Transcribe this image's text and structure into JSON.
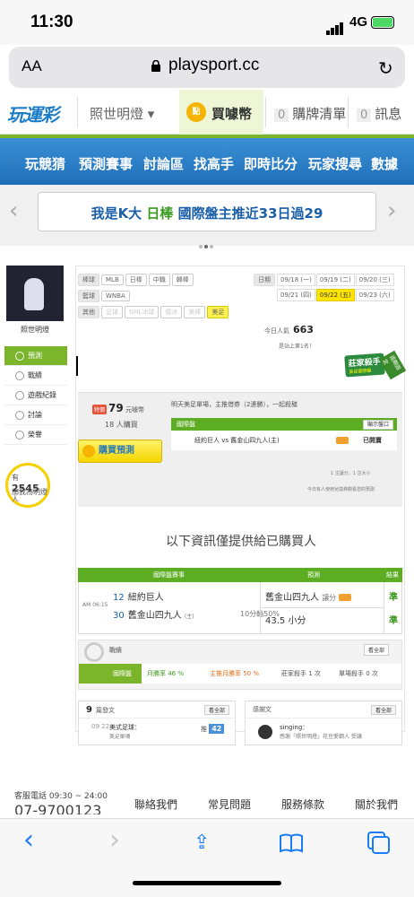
{
  "status_bar": {
    "time": "11:30",
    "network": "4G"
  },
  "browser": {
    "aa": "AA",
    "url": "playsport.cc",
    "reload": "↻"
  },
  "site_header": {
    "logo": "玩運彩",
    "menu": "照世明燈 ▾",
    "coin_icon": "點",
    "coin": "買噱幣",
    "cart_count": "0",
    "cart": "購牌清單",
    "msg_count": "0",
    "msg": "訊息"
  },
  "nav": {
    "items": [
      "玩競猜",
      "預測賽事",
      "討論區",
      "找高手",
      "即時比分",
      "玩家搜尋",
      "數據"
    ]
  },
  "marquee": {
    "prefix": "我是K大",
    "highlight": "日棒",
    "text": "國際盤主推近33日過29",
    "left_arrow": "‹",
    "right_arrow": "›"
  },
  "sidebar": {
    "username": "照世明燈",
    "items": [
      {
        "label": "預測",
        "active": true
      },
      {
        "label": "戰績",
        "active": false
      },
      {
        "label": "遊戲紀錄",
        "active": false
      },
      {
        "label": "討論",
        "active": false
      },
      {
        "label": "榮譽",
        "active": false
      }
    ],
    "bulb": {
      "prefix": "有",
      "count": "2545",
      "unit": "人",
      "line2": "加我為明燈"
    }
  },
  "filters": {
    "row1": {
      "label": "棒球",
      "tags": [
        "MLB",
        "日棒",
        "中職",
        "韓棒"
      ]
    },
    "row2": {
      "label": "籃球",
      "tags": [
        "WNBA"
      ]
    },
    "row3": {
      "label": "其他",
      "tags": [
        "足球",
        "NHL冰球",
        "俄冰",
        "美棒",
        "美足"
      ]
    }
  },
  "dates": {
    "label": "日期",
    "items": [
      "09/18 (一)",
      "09/19 (二)",
      "09/20 (三)",
      "09/21 (四)",
      "09/22 (五)",
      "09/23 (六)"
    ],
    "selected": "09/22 (五)"
  },
  "stats": {
    "views_label": "今日人氣",
    "views": "663",
    "rank": "是站上第1名！"
  },
  "badge": {
    "title": "莊家殺手",
    "sub": "美足國際盤",
    "ribbon": "週期固定"
  },
  "purchase": {
    "hot": "特價",
    "price": "79",
    "price_unit": "元噱幣",
    "buyers": "18 人購買",
    "button": "購買預測",
    "tomorrow": "明天美足單場，主推借券（2連勝），一起殺豬",
    "mini_header": "國際盤",
    "mini_show": "顯示盤口",
    "mini_row": "紐約巨人 vs 舊金山四九人(主)",
    "mini_sold": "已開賣",
    "rule": "1 注讓分，1 注大小",
    "notice": "今日有人使用兌換券觀看您的預測"
  },
  "only_paid": "以下資訊僅提供給已購買人",
  "prediction": {
    "headers": [
      "國際盤賽事",
      "預測",
      "結果"
    ],
    "time": "AM 06:15",
    "team1_num": "12",
    "team1": "紐約巨人",
    "team2_num": "30",
    "team2": "舊金山四九人",
    "team2_tag": "(主)",
    "odds": "10分輸50%",
    "pick1": "舊金山四九人",
    "pick1_type": "讓分",
    "pick2": "43.5 小分",
    "result1": "準",
    "result2": "準"
  },
  "record": {
    "title": "戰績",
    "all": "看全部",
    "segments": [
      "國際盤",
      "月勝率 46 %",
      "主推月勝率 50 %",
      "莊家殺手 1 次",
      "單場殺手 0 次"
    ]
  },
  "posts": {
    "left": {
      "count": "9",
      "title": "篇發文",
      "all": "看全部",
      "date": "09 22",
      "subject": "美式足球：",
      "sub": "美足單場",
      "push_label": "推",
      "push": "42"
    },
    "right": {
      "title": "感謝文",
      "all": "看全部",
      "user": "singing：",
      "text": "感謝「照世明燈」花豆愛鋼人 受讓"
    }
  },
  "footer": {
    "service": "客服電話 09:30 ~ 24:00",
    "phone": "07-9700123",
    "links": [
      "聯絡我們",
      "常見問題",
      "服務條款",
      "關於我們"
    ]
  },
  "toolbar": {
    "back": "‹",
    "forward": "›",
    "share": "⇪",
    "bookmarks": "📖",
    "tabs": "⧉"
  }
}
